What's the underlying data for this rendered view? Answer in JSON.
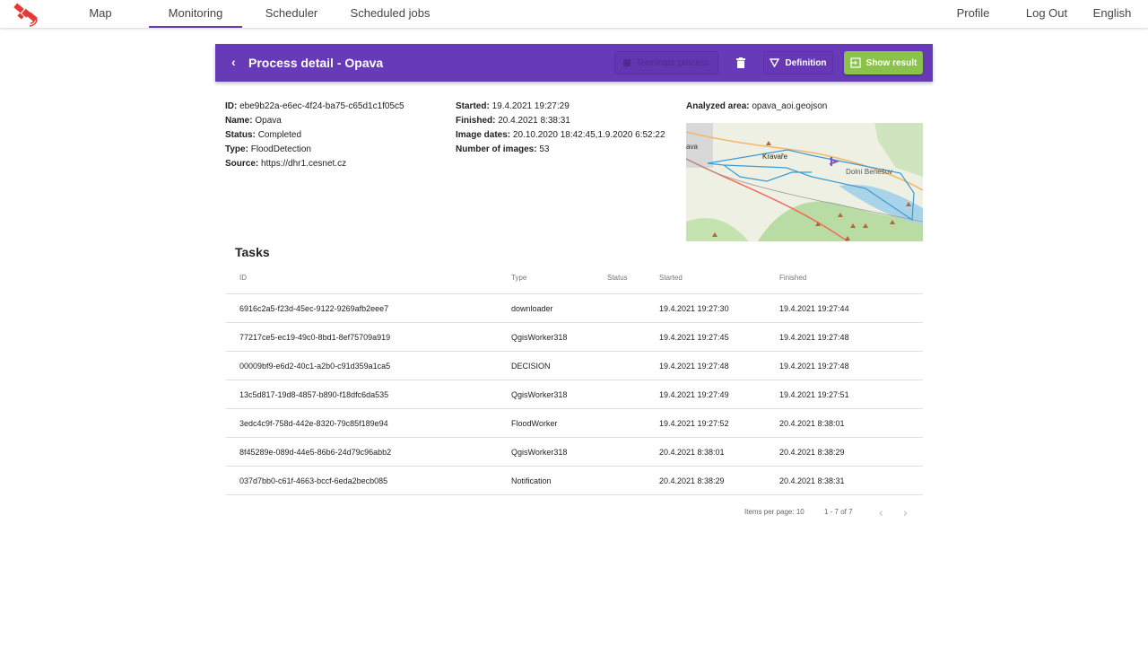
{
  "nav": {
    "tabs": [
      {
        "label": "Map",
        "active": false
      },
      {
        "label": "Monitoring",
        "active": true
      },
      {
        "label": "Scheduler",
        "active": false
      },
      {
        "label": "Scheduled jobs",
        "active": false
      }
    ],
    "right": {
      "profile": "Profile",
      "logout": "Log Out",
      "language": "English"
    },
    "logo_color": "#e53935"
  },
  "header": {
    "title": "Process detail - Opava",
    "terminate": "Terminate process",
    "definition": "Definition",
    "show_result": "Show result",
    "accent": "#673ab7",
    "show_result_color": "#8bc34a"
  },
  "details": {
    "col1": [
      {
        "k": "ID:",
        "v": "ebe9b22a-e6ec-4f24-ba75-c65d1c1f05c5"
      },
      {
        "k": "Name:",
        "v": "Opava"
      },
      {
        "k": "Status:",
        "v": "Completed"
      },
      {
        "k": "Type:",
        "v": "FloodDetection"
      },
      {
        "k": "Source:",
        "v": "https://dhr1.cesnet.cz"
      }
    ],
    "col2": [
      {
        "k": "Started:",
        "v": "19.4.2021 19:27:29"
      },
      {
        "k": "Finished:",
        "v": "20.4.2021 8:38:31"
      },
      {
        "k": "Image dates:",
        "v": "20.10.2020 18:42:45,1.9.2020 6:52:22"
      },
      {
        "k": "Number of images:",
        "v": "53"
      }
    ],
    "area": {
      "k": "Analyzed area:",
      "v": "opava_aoi.geojson"
    },
    "map_labels": {
      "a": "ava",
      "b": "Kravaře",
      "c": "Dolní Benešov"
    }
  },
  "tasks": {
    "title": "Tasks",
    "columns": [
      "ID",
      "Type",
      "Status",
      "Started",
      "Finished"
    ],
    "rows": [
      [
        "6916c2a5-f23d-45ec-9122-9269afb2eee7",
        "downloader",
        "",
        "19.4.2021 19:27:30",
        "19.4.2021 19:27:44"
      ],
      [
        "77217ce5-ec19-49c0-8bd1-8ef75709a919",
        "QgisWorker318",
        "",
        "19.4.2021 19:27:45",
        "19.4.2021 19:27:48"
      ],
      [
        "00009bf9-e6d2-40c1-a2b0-c91d359a1ca5",
        "DECISION",
        "",
        "19.4.2021 19:27:48",
        "19.4.2021 19:27:48"
      ],
      [
        "13c5d817-19d8-4857-b890-f18dfc6da535",
        "QgisWorker318",
        "",
        "19.4.2021 19:27:49",
        "19.4.2021 19:27:51"
      ],
      [
        "3edc4c9f-758d-442e-8320-79c85f189e94",
        "FloodWorker",
        "",
        "19.4.2021 19:27:52",
        "20.4.2021 8:38:01"
      ],
      [
        "8f45289e-089d-44e5-86b6-24d79c96abb2",
        "QgisWorker318",
        "",
        "20.4.2021 8:38:01",
        "20.4.2021 8:38:29"
      ],
      [
        "037d7bb0-c61f-4663-bccf-6eda2becb085",
        "Notification",
        "",
        "20.4.2021 8:38:29",
        "20.4.2021 8:38:31"
      ]
    ]
  },
  "paginator": {
    "items_label": "Items per page:",
    "items_value": "10",
    "range": "1 - 7 of 7"
  }
}
